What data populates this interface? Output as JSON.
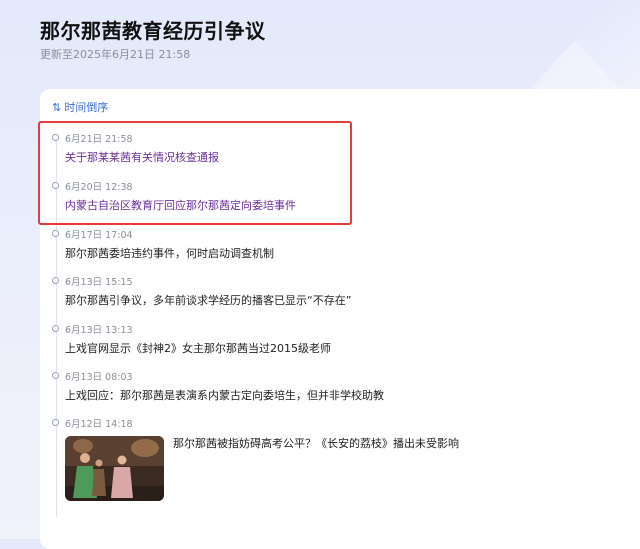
{
  "page": {
    "title": "那尔那茜教育经历引争议",
    "updated": "更新至2025年6月21日 21:58"
  },
  "timeline": {
    "sort_label": "时间倒序",
    "items": [
      {
        "time": "6月21日 21:58",
        "headline": "关于那某某茜有关情况核查通报",
        "visited": true
      },
      {
        "time": "6月20日 12:38",
        "headline": "内蒙古自治区教育厅回应那尔那茜定向委培事件",
        "visited": true
      },
      {
        "time": "6月17日 17:04",
        "headline": "那尔那茜委培违约事件，何时启动调查机制",
        "visited": false
      },
      {
        "time": "6月13日 15:15",
        "headline": "那尔那茜引争议，多年前谈求学经历的播客已显示“不存在”",
        "visited": false
      },
      {
        "time": "6月13日 13:13",
        "headline": "上戏官网显示《封神2》女主那尔那茜当过2015级老师",
        "visited": false
      },
      {
        "time": "6月13日 08:03",
        "headline": "上戏回应：那尔那茜是表演系内蒙古定向委培生，但并非学校助教",
        "visited": false
      },
      {
        "time": "6月12日 14:18",
        "headline": "那尔那茜被指妨碍高考公平？《长安的荔枝》播出未受影响",
        "visited": false,
        "has_thumbnail": true
      }
    ]
  },
  "colors": {
    "link_visited": "#6b2f9e",
    "accent": "#3a6fd8",
    "highlight": "#e53b3b"
  }
}
